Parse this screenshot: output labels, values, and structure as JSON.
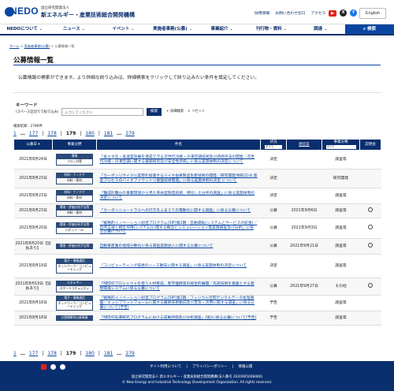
{
  "header": {
    "logo_text": "NEDO",
    "org_small": "国立研究開発法人",
    "org_name": "新エネルギー・産業技術総合開発機構",
    "links": [
      "採用情報",
      "お問い合わせ窓口",
      "アクセス"
    ],
    "lang": "English"
  },
  "nav": {
    "items": [
      "NEDOについて",
      "ニュース",
      "イベント",
      "実施者事務(公募)",
      "事業紹介",
      "刊行物・資料",
      "調達"
    ],
    "search": "検索"
  },
  "breadcrumb": [
    "ホーム",
    "実施者事務(公募)",
    "公募情報一覧"
  ],
  "page": {
    "title": "公募情報一覧",
    "intro": "公募情報の検索ができます。より詳細な絞り込みは、詳細検索をクリックして絞り込みたい条件を設定してください。"
  },
  "search": {
    "label": "キーワード",
    "sub": "(スペース区切りで絞り込み)",
    "placeholder": "入力してください",
    "button": "検索",
    "detail": "+ 詳細検索",
    "reset": "× リセット"
  },
  "count": "検索結果：2789件",
  "pager": {
    "first": "1",
    "ellipsis1": "…",
    "pages": [
      "177",
      "178",
      "179",
      "180",
      "181"
    ],
    "ellipsis2": "…",
    "last": "279",
    "current": "179"
  },
  "table": {
    "headers": {
      "date": "公募日",
      "category": "事業分野",
      "title": "件名",
      "status": "状況",
      "status_sel": "すべて",
      "deadline": "締切日",
      "type": "事業分類",
      "type_sel": "すべて",
      "explain": "説明会"
    },
    "rows": [
      {
        "date": "2021年8月24日",
        "cat_top": "環境",
        "cat_bot": "フロン対策",
        "title": "「省エネ化・低温室効果を達成できる次世代冷媒・冷凍空調技術及び評価手法の開発／次世代冷媒・冷凍空調に関する基礎研究及び安全性評価」に係る実施体制の決定について",
        "status": "決定",
        "deadline": "",
        "type": "調査等",
        "explain": ""
      },
      {
        "date": "2021年8月23日",
        "cat_top": "材料・ナノテク",
        "cat_bot": "材料・素材",
        "title": "「カーボンリサイクル実現を加速するバイオ由来製品生産技術の開発／研究開発項目(2)-b 高度プロセスのバイオファウンドリ基盤技術開発」に係る実施体制の決定 について",
        "status": "決定",
        "deadline": "",
        "type": "研究開発",
        "explain": ""
      },
      {
        "date": "2021年8月23日",
        "cat_top": "材料・ナノテク",
        "cat_bot": "材料・素材",
        "title": "「難成形難分の事業環境から見た革命型製造技術、特化した分析の調査」に係る実施体制の決定について",
        "status": "決定",
        "deadline": "",
        "type": "調査等",
        "explain": ""
      },
      {
        "date": "2021年8月23日",
        "cat_top": "環境・評価分析手法等",
        "cat_bot": "材料・素材",
        "title": "「カーボンニュートラルへの行方をふまえての電動化に関する調査」に係る公募について",
        "status": "公募",
        "deadline": "2021年9月6日",
        "type": "調査等",
        "explain": "○"
      },
      {
        "date": "2021年8月20日",
        "cat_top": "環境・評価分析手法等",
        "cat_bot": "ロボット・AI",
        "title": "「戦略的イノベーション創造プログラム(SIP)第2期／自動運転(システムとサービスの拡張)／自然言語と相互作用(システム)に関する概念とシミュレーション等実施調査及び分析」に係る公募について",
        "status": "公募",
        "deadline": "2021年9月3日",
        "type": "調査等",
        "explain": "○"
      },
      {
        "date": "2021年8月20日【延長あり】",
        "cat_top": "環境・評価分析手法等",
        "cat_bot": "",
        "title": "自動車産業の地域分散化に係る調査実施加入に関する公募について",
        "status": "公募",
        "deadline": "2021年9月21日",
        "type": "調査等",
        "explain": "○"
      },
      {
        "date": "2021年8月19日",
        "cat_top": "電子・情報通信",
        "cat_bot": "ネットワーク／コンピューティング",
        "title": "「コンピューティング技術のニーズ動向に関する調査」に係る実施体制の決定について",
        "status": "決定",
        "deadline": "",
        "type": "調査等",
        "explain": ""
      },
      {
        "date": "2021年8月19日【延長あり】",
        "cat_top": "エネルギー",
        "cat_bot": "スマートコミュニティ",
        "title": "「NEDOプロジェクトを担う人材育成、産学連携等の総合的展開／先進技術を基盤とする発現環境システムに係る公募について",
        "status": "公募",
        "deadline": "2021年9月27日",
        "type": "その他",
        "explain": "○"
      },
      {
        "date": "2021年8月18日",
        "cat_top": "電子・情報通信",
        "cat_bot": "ネットワーク／コンピューティング",
        "title": "「戦略的イノベーション創造プログラム(SIP)第2期／フィジカル空間デジタルデータ処理基盤／エッジプラットフォームに関する最新技術動向及び普及・活用に関する調査」に係る公募について(予告)",
        "status": "予告",
        "deadline": "",
        "type": "調査等",
        "explain": ""
      },
      {
        "date": "2021年8月18日",
        "cat_top": "分野横断的公募事業",
        "cat_bot": "",
        "title": "「NEDO先導研究プログラムにおける成果評価及び分析調査」(仮)に係る公募について(予告)",
        "status": "予告",
        "deadline": "",
        "type": "調査等",
        "explain": ""
      }
    ]
  },
  "footer": {
    "links": [
      "サイト利用について",
      "プライバシーポリシー",
      "情報公開"
    ],
    "address": "国立研究開発法人 新エネルギー・産業技術総合開発機構(法人番号 2020005008480)",
    "copyright": "© New Energy and Industrial Technology Development Organization. All rights reserved."
  },
  "colors": {
    "brand": "#0a2f6e",
    "accent": "#0a46a0",
    "youtube": "#e62117"
  }
}
